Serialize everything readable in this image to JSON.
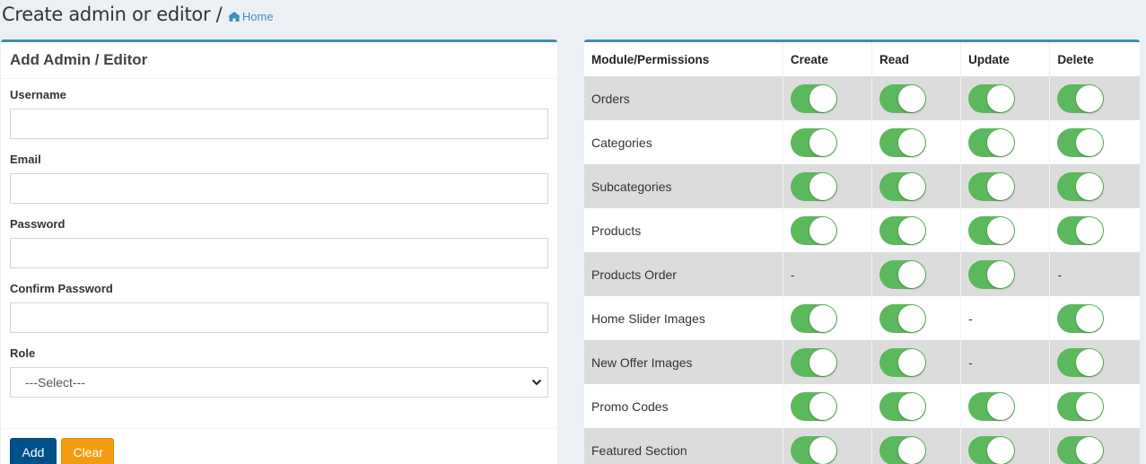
{
  "header": {
    "title": "Create admin or editor /",
    "breadcrumb_home": "Home"
  },
  "form": {
    "title": "Add Admin / Editor",
    "fields": [
      {
        "label": "Username",
        "value": "",
        "placeholder": ""
      },
      {
        "label": "Email",
        "value": "",
        "placeholder": ""
      },
      {
        "label": "Password",
        "value": "",
        "placeholder": ""
      },
      {
        "label": "Confirm Password",
        "value": "",
        "placeholder": ""
      }
    ],
    "role": {
      "label": "Role",
      "selected": "---Select---"
    },
    "add_label": "Add",
    "clear_label": "Clear"
  },
  "permissions": {
    "headers": [
      "Module/Permissions",
      "Create",
      "Read",
      "Update",
      "Delete"
    ],
    "dash": "-",
    "rows": [
      {
        "module": "Orders",
        "create": true,
        "read": true,
        "update": true,
        "delete": true
      },
      {
        "module": "Categories",
        "create": true,
        "read": true,
        "update": true,
        "delete": true
      },
      {
        "module": "Subcategories",
        "create": true,
        "read": true,
        "update": true,
        "delete": true
      },
      {
        "module": "Products",
        "create": true,
        "read": true,
        "update": true,
        "delete": true
      },
      {
        "module": "Products Order",
        "create": null,
        "read": true,
        "update": true,
        "delete": null
      },
      {
        "module": "Home Slider Images",
        "create": true,
        "read": true,
        "update": null,
        "delete": true
      },
      {
        "module": "New Offer Images",
        "create": true,
        "read": true,
        "update": null,
        "delete": true
      },
      {
        "module": "Promo Codes",
        "create": true,
        "read": true,
        "update": true,
        "delete": true
      },
      {
        "module": "Featured Section",
        "create": true,
        "read": true,
        "update": true,
        "delete": true
      }
    ]
  },
  "colors": {
    "accent": "#3c8dbc",
    "toggle_on": "#5cb85c",
    "add_button": "#00508a",
    "clear_button": "#f39c12"
  },
  "icons": {
    "breadcrumb": "home-icon",
    "select": "chevron-down-icon"
  }
}
